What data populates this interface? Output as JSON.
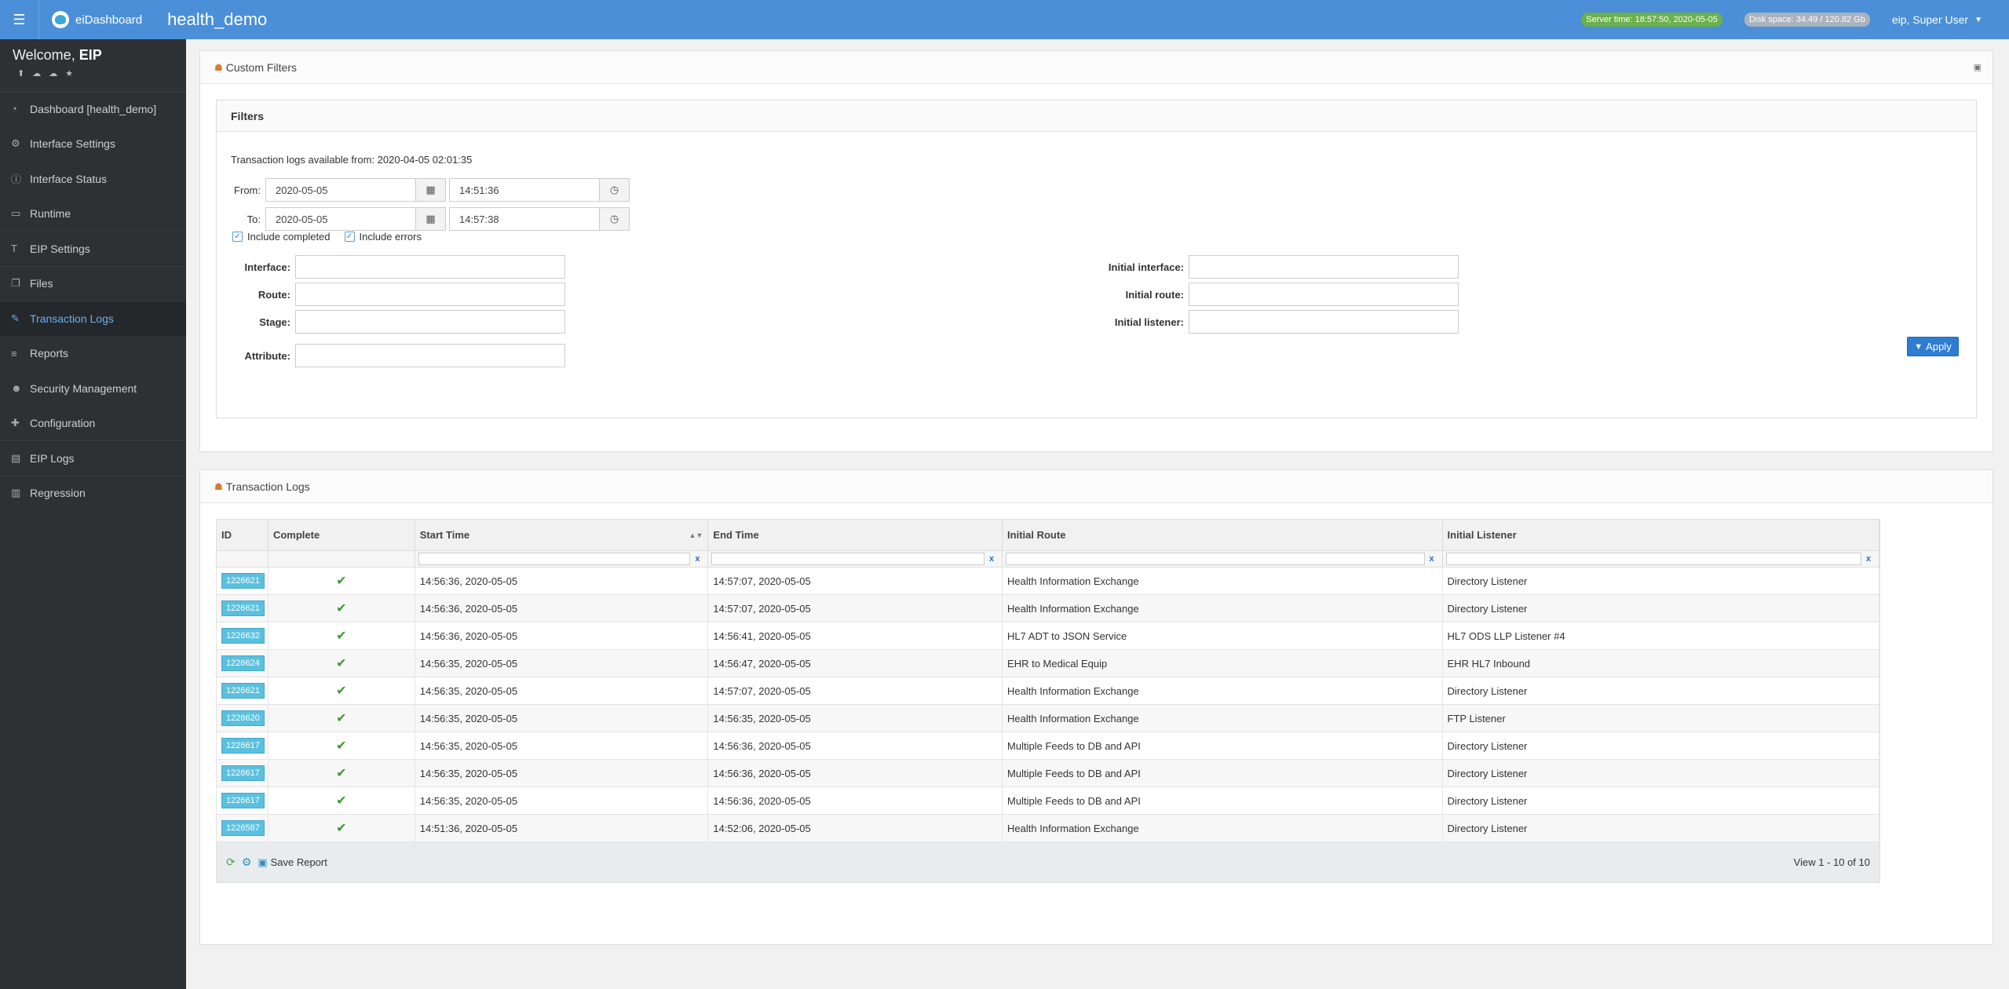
{
  "topbar": {
    "brand": "eiDashboard",
    "app_title": "health_demo",
    "server_time": "Server time: 18:57:50, 2020-05-05",
    "disk_space": "Disk space: 34.49 / 120.82 Gb",
    "user": "eip, Super User"
  },
  "sidebar": {
    "welcome_prefix": "Welcome,",
    "welcome_user": "EIP",
    "items": [
      {
        "label": "Dashboard [health_demo]",
        "icon": "dashboard-icon"
      },
      {
        "label": "Interface Settings",
        "icon": "cogs-icon"
      },
      {
        "label": "Interface Status",
        "icon": "info-icon"
      },
      {
        "label": "Runtime",
        "icon": "monitor-icon"
      },
      {
        "label": "EIP Settings",
        "icon": "text-height-icon"
      },
      {
        "label": "Files",
        "icon": "files-icon"
      },
      {
        "label": "Transaction Logs",
        "icon": "edit-icon"
      },
      {
        "label": "Reports",
        "icon": "list-icon"
      },
      {
        "label": "Security Management",
        "icon": "users-icon"
      },
      {
        "label": "Configuration",
        "icon": "puzzle-icon"
      },
      {
        "label": "EIP Logs",
        "icon": "file-icon"
      },
      {
        "label": "Regression",
        "icon": "bar-chart-icon"
      }
    ]
  },
  "custom_filters": {
    "title": "Custom Filters",
    "filters_title": "Filters",
    "available_from": "Transaction logs available from: 2020-04-05 02:01:35",
    "from_label": "From:",
    "from_date": "2020-05-05",
    "from_time": "14:51:36",
    "to_label": "To:",
    "to_date": "2020-05-05",
    "to_time": "14:57:38",
    "include_completed": "Include completed",
    "include_errors": "Include errors",
    "interface_label": "Interface:",
    "route_label": "Route:",
    "stage_label": "Stage:",
    "attribute_label": "Attribute:",
    "initial_interface_label": "Initial interface:",
    "initial_route_label": "Initial route:",
    "initial_listener_label": "Initial listener:",
    "apply": "Apply"
  },
  "transaction_logs": {
    "title": "Transaction Logs",
    "columns": [
      "ID",
      "Complete",
      "Start Time",
      "End Time",
      "Initial Route",
      "Initial Listener"
    ],
    "clear": "x",
    "rows": [
      {
        "id": "1226621",
        "start": "14:56:36, 2020-05-05",
        "end": "14:57:07, 2020-05-05",
        "route": "Health Information Exchange",
        "listener": "Directory Listener"
      },
      {
        "id": "1226621",
        "start": "14:56:36, 2020-05-05",
        "end": "14:57:07, 2020-05-05",
        "route": "Health Information Exchange",
        "listener": "Directory Listener"
      },
      {
        "id": "1226632",
        "start": "14:56:36, 2020-05-05",
        "end": "14:56:41, 2020-05-05",
        "route": "HL7 ADT to JSON Service",
        "listener": "HL7 ODS LLP Listener #4"
      },
      {
        "id": "1226624",
        "start": "14:56:35, 2020-05-05",
        "end": "14:56:47, 2020-05-05",
        "route": "EHR to Medical Equip",
        "listener": "EHR HL7 Inbound"
      },
      {
        "id": "1226621",
        "start": "14:56:35, 2020-05-05",
        "end": "14:57:07, 2020-05-05",
        "route": "Health Information Exchange",
        "listener": "Directory Listener"
      },
      {
        "id": "1226620",
        "start": "14:56:35, 2020-05-05",
        "end": "14:56:35, 2020-05-05",
        "route": "Health Information Exchange",
        "listener": "FTP Listener"
      },
      {
        "id": "1226617",
        "start": "14:56:35, 2020-05-05",
        "end": "14:56:36, 2020-05-05",
        "route": "Multiple Feeds to DB and API",
        "listener": "Directory Listener"
      },
      {
        "id": "1226617",
        "start": "14:56:35, 2020-05-05",
        "end": "14:56:36, 2020-05-05",
        "route": "Multiple Feeds to DB and API",
        "listener": "Directory Listener"
      },
      {
        "id": "1226617",
        "start": "14:56:35, 2020-05-05",
        "end": "14:56:36, 2020-05-05",
        "route": "Multiple Feeds to DB and API",
        "listener": "Directory Listener"
      },
      {
        "id": "1226587",
        "start": "14:51:36, 2020-05-05",
        "end": "14:52:06, 2020-05-05",
        "route": "Health Information Exchange",
        "listener": "Directory Listener"
      }
    ],
    "save_report": "Save Report",
    "view_count": "View 1 - 10 of 10"
  }
}
